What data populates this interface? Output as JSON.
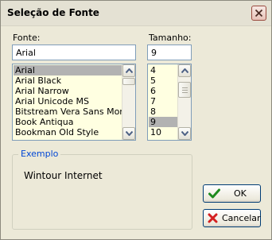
{
  "window": {
    "title": "Seleção de Fonte"
  },
  "font": {
    "label": "Fonte:",
    "value": "Arial",
    "items": [
      "Arial",
      "Arial Black",
      "Arial Narrow",
      "Arial Unicode MS",
      "Bitstream Vera Sans Mono",
      "Book Antiqua",
      "Bookman Old Style"
    ],
    "selected_index": 0
  },
  "size": {
    "label": "Tamanho:",
    "value": "9",
    "items": [
      "4",
      "5",
      "6",
      "7",
      "8",
      "9",
      "10"
    ],
    "selected_index": 5
  },
  "example": {
    "label": "Exemplo",
    "text": "Wintour Internet"
  },
  "buttons": {
    "ok_label": "OK",
    "cancel_label": "Cancelar"
  },
  "icons": {
    "close": "close-icon",
    "ok": "checkmark-icon",
    "cancel": "red-x-icon",
    "scroll_up": "arrow-up-icon",
    "scroll_down": "arrow-down-icon"
  },
  "colors": {
    "list_background": "#ffffe1",
    "selection": "#b2b2b2",
    "group_label": "#0046d5",
    "ok_icon": "#1e8a1e",
    "cancel_icon": "#d42020"
  }
}
